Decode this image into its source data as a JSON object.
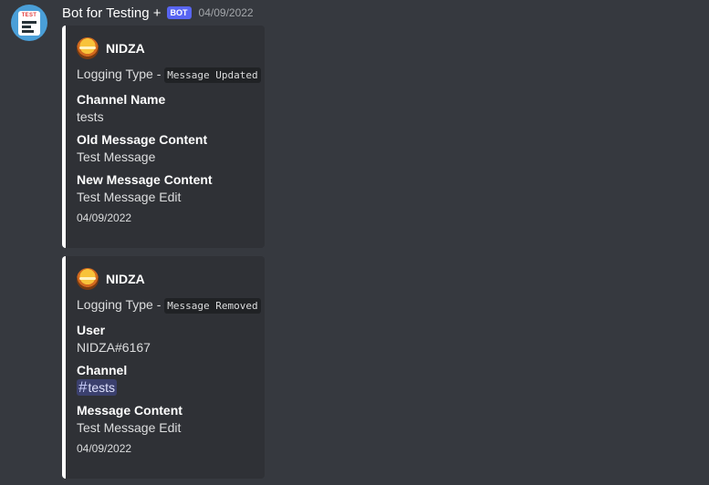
{
  "message": {
    "username": "Bot for Testing +",
    "bot_tag": "BOT",
    "timestamp": "04/09/2022",
    "avatar_text": "TEST"
  },
  "embeds": [
    {
      "author": "NIDZA",
      "description_prefix": "Logging Type - ",
      "description_code": "Message Updated",
      "fields": [
        {
          "name": "Channel Name",
          "value": "tests"
        },
        {
          "name": "Old Message Content",
          "value": "Test Message"
        },
        {
          "name": "New Message Content",
          "value": "Test Message Edit"
        }
      ],
      "footer": "04/09/2022"
    },
    {
      "author": "NIDZA",
      "description_prefix": "Logging Type - ",
      "description_code": "Message Removed",
      "fields": [
        {
          "name": "User",
          "value": "NIDZA#6167"
        },
        {
          "name": "Channel",
          "value": "tests",
          "mention_prefix": "#"
        },
        {
          "name": "Message Content",
          "value": "Test Message Edit"
        }
      ],
      "footer": "04/09/2022"
    }
  ],
  "colors": {
    "background": "#36393f",
    "embed_bg": "#2f3136",
    "embed_border": "#ffffff",
    "bot_tag": "#5865f2"
  }
}
